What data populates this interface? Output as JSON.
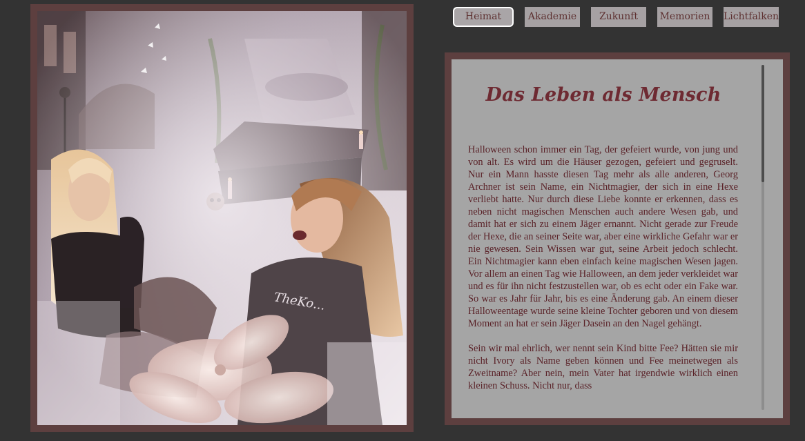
{
  "nav": {
    "items": [
      {
        "label": "Heimat",
        "active": true
      },
      {
        "label": "Akademie",
        "active": false
      },
      {
        "label": "Zukunft",
        "active": false
      },
      {
        "label": "Memorien",
        "active": false
      },
      {
        "label": "Lichtfalken",
        "active": false
      }
    ]
  },
  "picture": {
    "decorative_text": "TheKo..."
  },
  "article": {
    "title": "Das Leben als Mensch",
    "paragraphs": [
      "Halloween schon immer ein Tag, der gefeiert wurde, von jung und von alt. Es wird um die Häuser gezogen, gefeiert und gegruselt. Nur ein Mann hasste diesen Tag mehr als alle anderen, Georg Archner ist sein Name, ein Nichtmagier, der sich in eine Hexe verliebt hatte. Nur durch diese Liebe konnte er erkennen, dass es neben nicht magischen Menschen auch andere Wesen gab, und damit hat er sich zu einem Jäger ernannt. Nicht gerade zur Freude der Hexe, die an seiner Seite war, aber eine wirkliche Gefahr war er nie gewesen. Sein Wissen war gut, seine Arbeit jedoch schlecht. Ein Nichtmagier kann eben einfach keine magischen Wesen jagen. Vor allem an einen Tag wie Halloween, an dem jeder verkleidet war und es für ihn nicht festzustellen war, ob es echt oder ein Fake war. So war es Jahr für Jahr, bis es eine Änderung gab. An einem dieser Halloweentage wurde seine kleine Tochter geboren und von diesem Moment an hat er sein Jäger Dasein an den Nagel gehängt.",
      "Sein wir mal ehrlich, wer nennt sein Kind bitte Fee? Hätten sie mir nicht Ivory als Name geben können und Fee meinetwegen als Zweitname? Aber nein, mein Vater hat irgendwie wirklich einen kleinen Schuss. Nicht nur, dass"
    ]
  },
  "colors": {
    "background": "#333333",
    "frame": "#5d3f3f",
    "panel": "#a5a5a5",
    "nav_button": "#a6a1a3",
    "accent_text": "#6e2a32"
  }
}
